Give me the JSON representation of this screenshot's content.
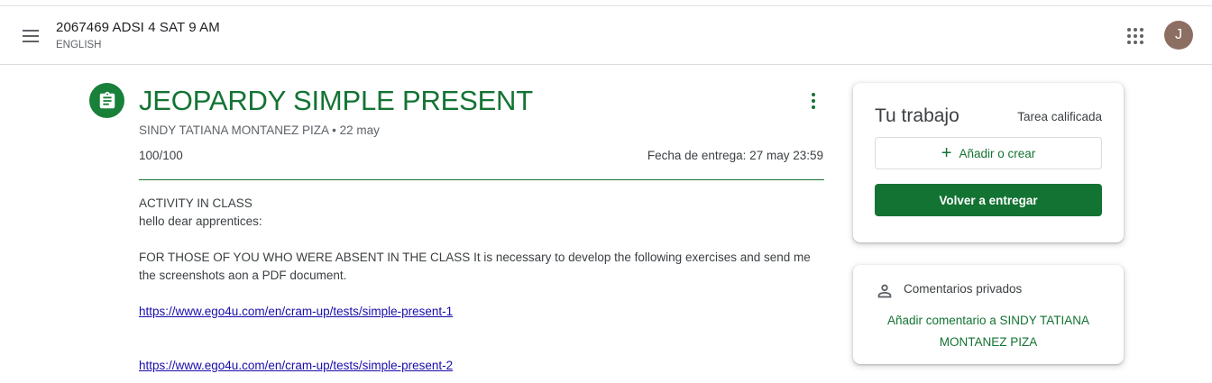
{
  "header": {
    "course_title": "2067469 ADSI 4 SAT 9 AM",
    "course_subtitle": "ENGLISH",
    "avatar_letter": "J",
    "menu_icon": "hamburger-menu-icon",
    "apps_icon": "google-apps-icon"
  },
  "assignment": {
    "icon": "assignment-icon",
    "title": "JEOPARDY SIMPLE PRESENT",
    "author": "SINDY TATIANA MONTANEZ PIZA",
    "separator": "•",
    "posted_date": "22 may",
    "points": "100/100",
    "due": "Fecha de entrega: 27 may 23:59"
  },
  "description": {
    "line1": "ACTIVITY IN CLASS",
    "line2": "hello dear apprentices:",
    "line3": "FOR THOSE OF YOU WHO WERE ABSENT IN THE CLASS It is necessary to develop the following exercises and send me the screenshots aon a PDF document.",
    "link1": "https://www.ego4u.com/en/cram-up/tests/simple-present-1",
    "link2": "https://www.ego4u.com/en/cram-up/tests/simple-present-2"
  },
  "your_work": {
    "title": "Tu trabajo",
    "status": "Tarea calificada",
    "add_label": "Añadir o crear",
    "submit_label": "Volver a entregar"
  },
  "private_comments": {
    "title": "Comentarios privados",
    "add_label": "Añadir comentario a SINDY TATIANA MONTANEZ PIZA",
    "icon": "person-icon"
  },
  "colors": {
    "accent": "#137333",
    "link": "#1a0dab",
    "avatar": "#8d6e63"
  }
}
